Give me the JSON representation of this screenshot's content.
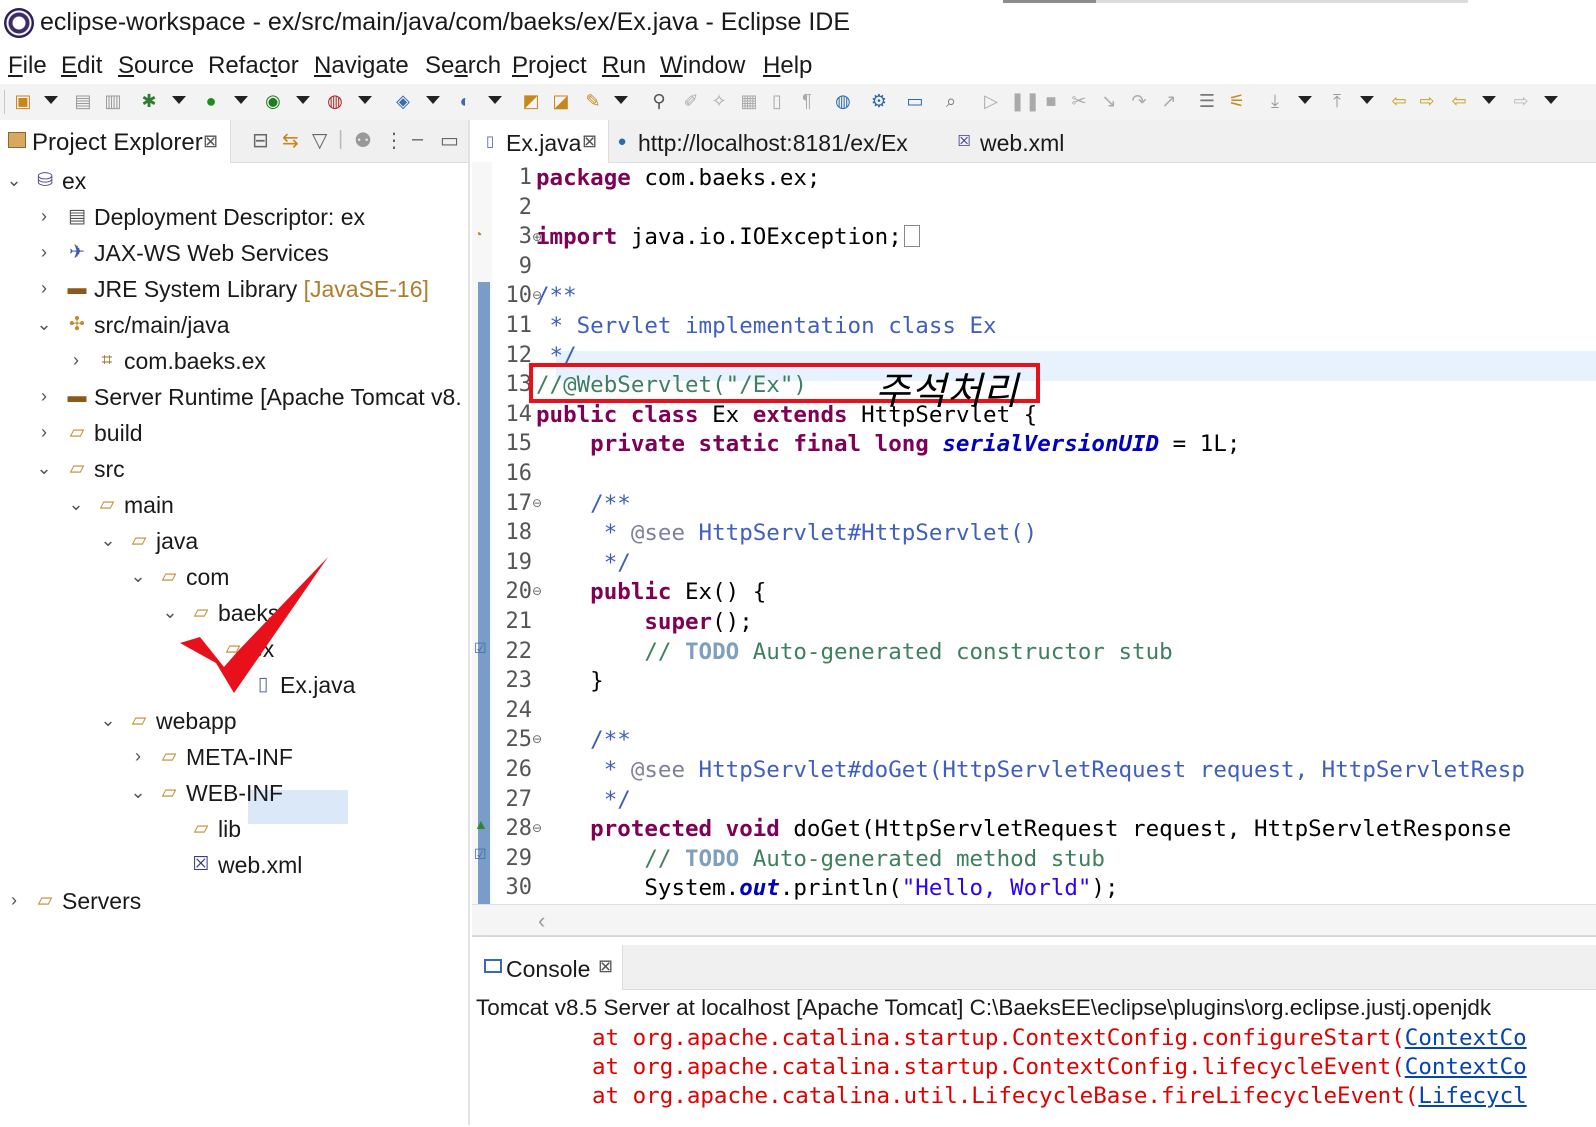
{
  "window": {
    "title": "eclipse-workspace - ex/src/main/java/com/baeks/ex/Ex.java - Eclipse IDE"
  },
  "menu": [
    {
      "label": "File",
      "mnemonic": "F",
      "rest": "ile"
    },
    {
      "label": "Edit",
      "mnemonic": "E",
      "rest": "dit"
    },
    {
      "label": "Source",
      "mnemonic": "S",
      "rest": "ource"
    },
    {
      "label": "Refactor",
      "mnemonic": "",
      "rest": "Refac",
      "mn2": "t",
      "rest2": "or"
    },
    {
      "label": "Navigate",
      "mnemonic": "N",
      "rest": "avigate"
    },
    {
      "label": "Search",
      "mnemonic": "",
      "rest": "Se",
      "mn2": "a",
      "rest2": "rch"
    },
    {
      "label": "Project",
      "mnemonic": "P",
      "rest": "roject"
    },
    {
      "label": "Run",
      "mnemonic": "R",
      "rest": "un"
    },
    {
      "label": "Window",
      "mnemonic": "W",
      "rest": "indow"
    },
    {
      "label": "Help",
      "mnemonic": "H",
      "rest": "elp"
    }
  ],
  "explorer": {
    "tab_label": "Project Explorer",
    "close_glyph": "⊠",
    "tree": {
      "ex": "ex",
      "deployment": "Deployment Descriptor: ex",
      "jaxws": "JAX-WS Web Services",
      "jre": "JRE System Library",
      "jre_decor": "[JavaSE-16]",
      "src_main_java": "src/main/java",
      "pkg": "com.baeks.ex",
      "server_runtime": "Server Runtime [Apache Tomcat v8.",
      "build": "build",
      "src": "src",
      "main": "main",
      "java": "java",
      "com": "com",
      "baeks": "baeks",
      "ex_folder": "ex",
      "exjava": "Ex.java",
      "webapp": "webapp",
      "metainf": "META-INF",
      "webinf": "WEB-INF",
      "lib": "lib",
      "webxml": "web.xml",
      "servers": "Servers"
    }
  },
  "editor": {
    "tabs": [
      {
        "label": "Ex.java"
      },
      {
        "label": "http://localhost:8181/ex/Ex"
      },
      {
        "label": "web.xml"
      }
    ],
    "line_numbers": [
      "1",
      "2",
      "3",
      "9",
      "10",
      "11",
      "12",
      "13",
      "14",
      "15",
      "16",
      "17",
      "18",
      "19",
      "20",
      "21",
      "22",
      "23",
      "24",
      "25",
      "26",
      "27",
      "28",
      "29",
      "30"
    ],
    "code": {
      "l1_kw": "package",
      "l1_rest": " com.baeks.ex;",
      "l3_kw": "import",
      "l3_rest": " java.io.IOException;",
      "l10": "/**",
      "l11": " * Servlet implementation class Ex",
      "l12": " */",
      "l13": "//@WebServlet(\"/Ex\")",
      "l14_kw1": "public",
      "l14_kw2": "class",
      "l14_mid": " Ex ",
      "l14_kw3": "extends",
      "l14_rest": " HttpServlet {",
      "l15_kw": "    private static final long ",
      "l15_field": "serialVersionUID",
      "l15_rest": " = 1L;",
      "l17": "    /**",
      "l18_pre": "     * ",
      "l18_tag": "@see",
      "l18_rest": " HttpServlet#HttpServlet()",
      "l19": "     */",
      "l20_kw": "    public",
      "l20_rest": " Ex() {",
      "l21_kw": "        super",
      "l21_rest": "();",
      "l22_pre": "        // ",
      "l22_todo": "TODO",
      "l22_rest": " Auto-generated constructor stub",
      "l23": "    }",
      "l25": "    /**",
      "l26_pre": "     * ",
      "l26_tag": "@see",
      "l26_rest": " HttpServlet#doGet(HttpServletRequest request, HttpServletResp",
      "l27": "     */",
      "l28_kw": "    protected void",
      "l28_rest": " doGet(HttpServletRequest request, HttpServletResponse",
      "l29_pre": "        // ",
      "l29_todo": "TODO",
      "l29_rest": " Auto-generated method stub",
      "l30_pre": "        System.",
      "l30_out": "out",
      "l30_mid": ".println(",
      "l30_str": "\"Hello, World\"",
      "l30_end": ");"
    }
  },
  "annotation": {
    "text": "주석처리",
    "color": "#e8101a"
  },
  "console": {
    "tab_label": "Console",
    "description": "Tomcat v8.5 Server at localhost [Apache Tomcat] C:\\BaeksEE\\eclipse\\plugins\\org.eclipse.justj.openjdk",
    "lines": [
      {
        "text": "at org.apache.catalina.startup.ContextConfig.configureStart(",
        "link": "ContextCo"
      },
      {
        "text": "at org.apache.catalina.startup.ContextConfig.lifecycleEvent(",
        "link": "ContextCo"
      },
      {
        "text": "at org.apache.catalina.util.LifecycleBase.fireLifecycleEvent(",
        "link": "Lifecycl"
      }
    ]
  }
}
